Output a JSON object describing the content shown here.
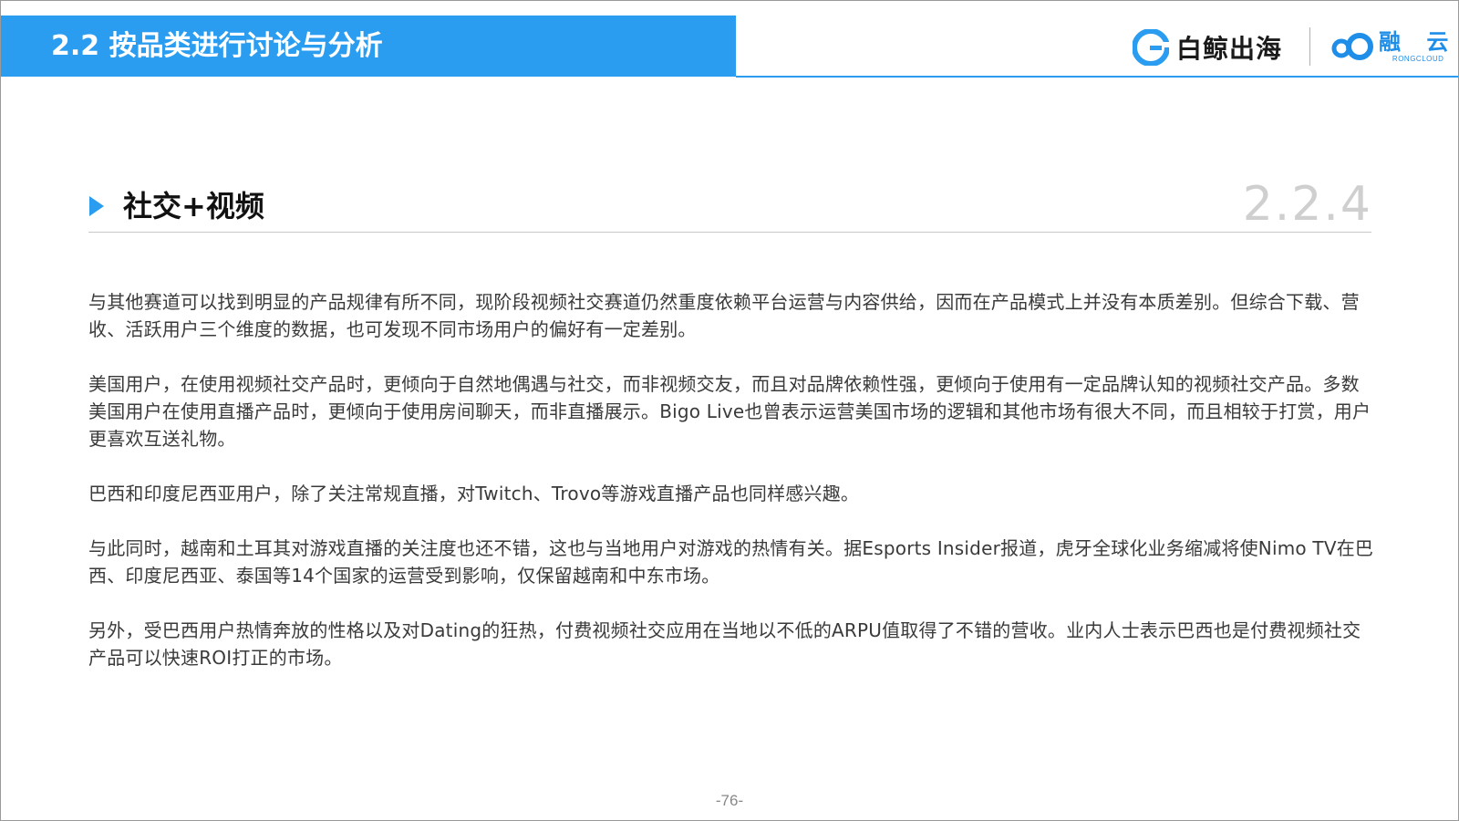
{
  "header": {
    "title": "2.2 按品类进行讨论与分析",
    "logo_baijing": "白鲸出海",
    "logo_rong": "融 云",
    "logo_rong_sub": "RONGCLOUD",
    "accent_color": "#2b9df0"
  },
  "section": {
    "title": "社交+视频",
    "number": "2.2.4"
  },
  "paragraphs": [
    "与其他赛道可以找到明显的产品规律有所不同，现阶段视频社交赛道仍然重度依赖平台运营与内容供给，因而在产品模式上并没有本质差别。但综合下载、营收、活跃用户三个维度的数据，也可发现不同市场用户的偏好有一定差别。",
    "美国用户，在使用视频社交产品时，更倾向于自然地偶遇与社交，而非视频交友，而且对品牌依赖性强，更倾向于使用有一定品牌认知的视频社交产品。多数美国用户在使用直播产品时，更倾向于使用房间聊天，而非直播展示。Bigo Live也曾表示运营美国市场的逻辑和其他市场有很大不同，而且相较于打赏，用户更喜欢互送礼物。",
    "巴西和印度尼西亚用户，除了关注常规直播，对Twitch、Trovo等游戏直播产品也同样感兴趣。",
    "与此同时，越南和土耳其对游戏直播的关注度也还不错，这也与当地用户对游戏的热情有关。据Esports Insider报道，虎牙全球化业务缩减将使Nimo TV在巴西、印度尼西亚、泰国等14个国家的运营受到影响，仅保留越南和中东市场。",
    "另外，受巴西用户热情奔放的性格以及对Dating的狂热，付费视频社交应用在当地以不低的ARPU值取得了不错的营收。业内人士表示巴西也是付费视频社交产品可以快速ROI打正的市场。"
  ],
  "footer": {
    "page_number": "-76-"
  }
}
